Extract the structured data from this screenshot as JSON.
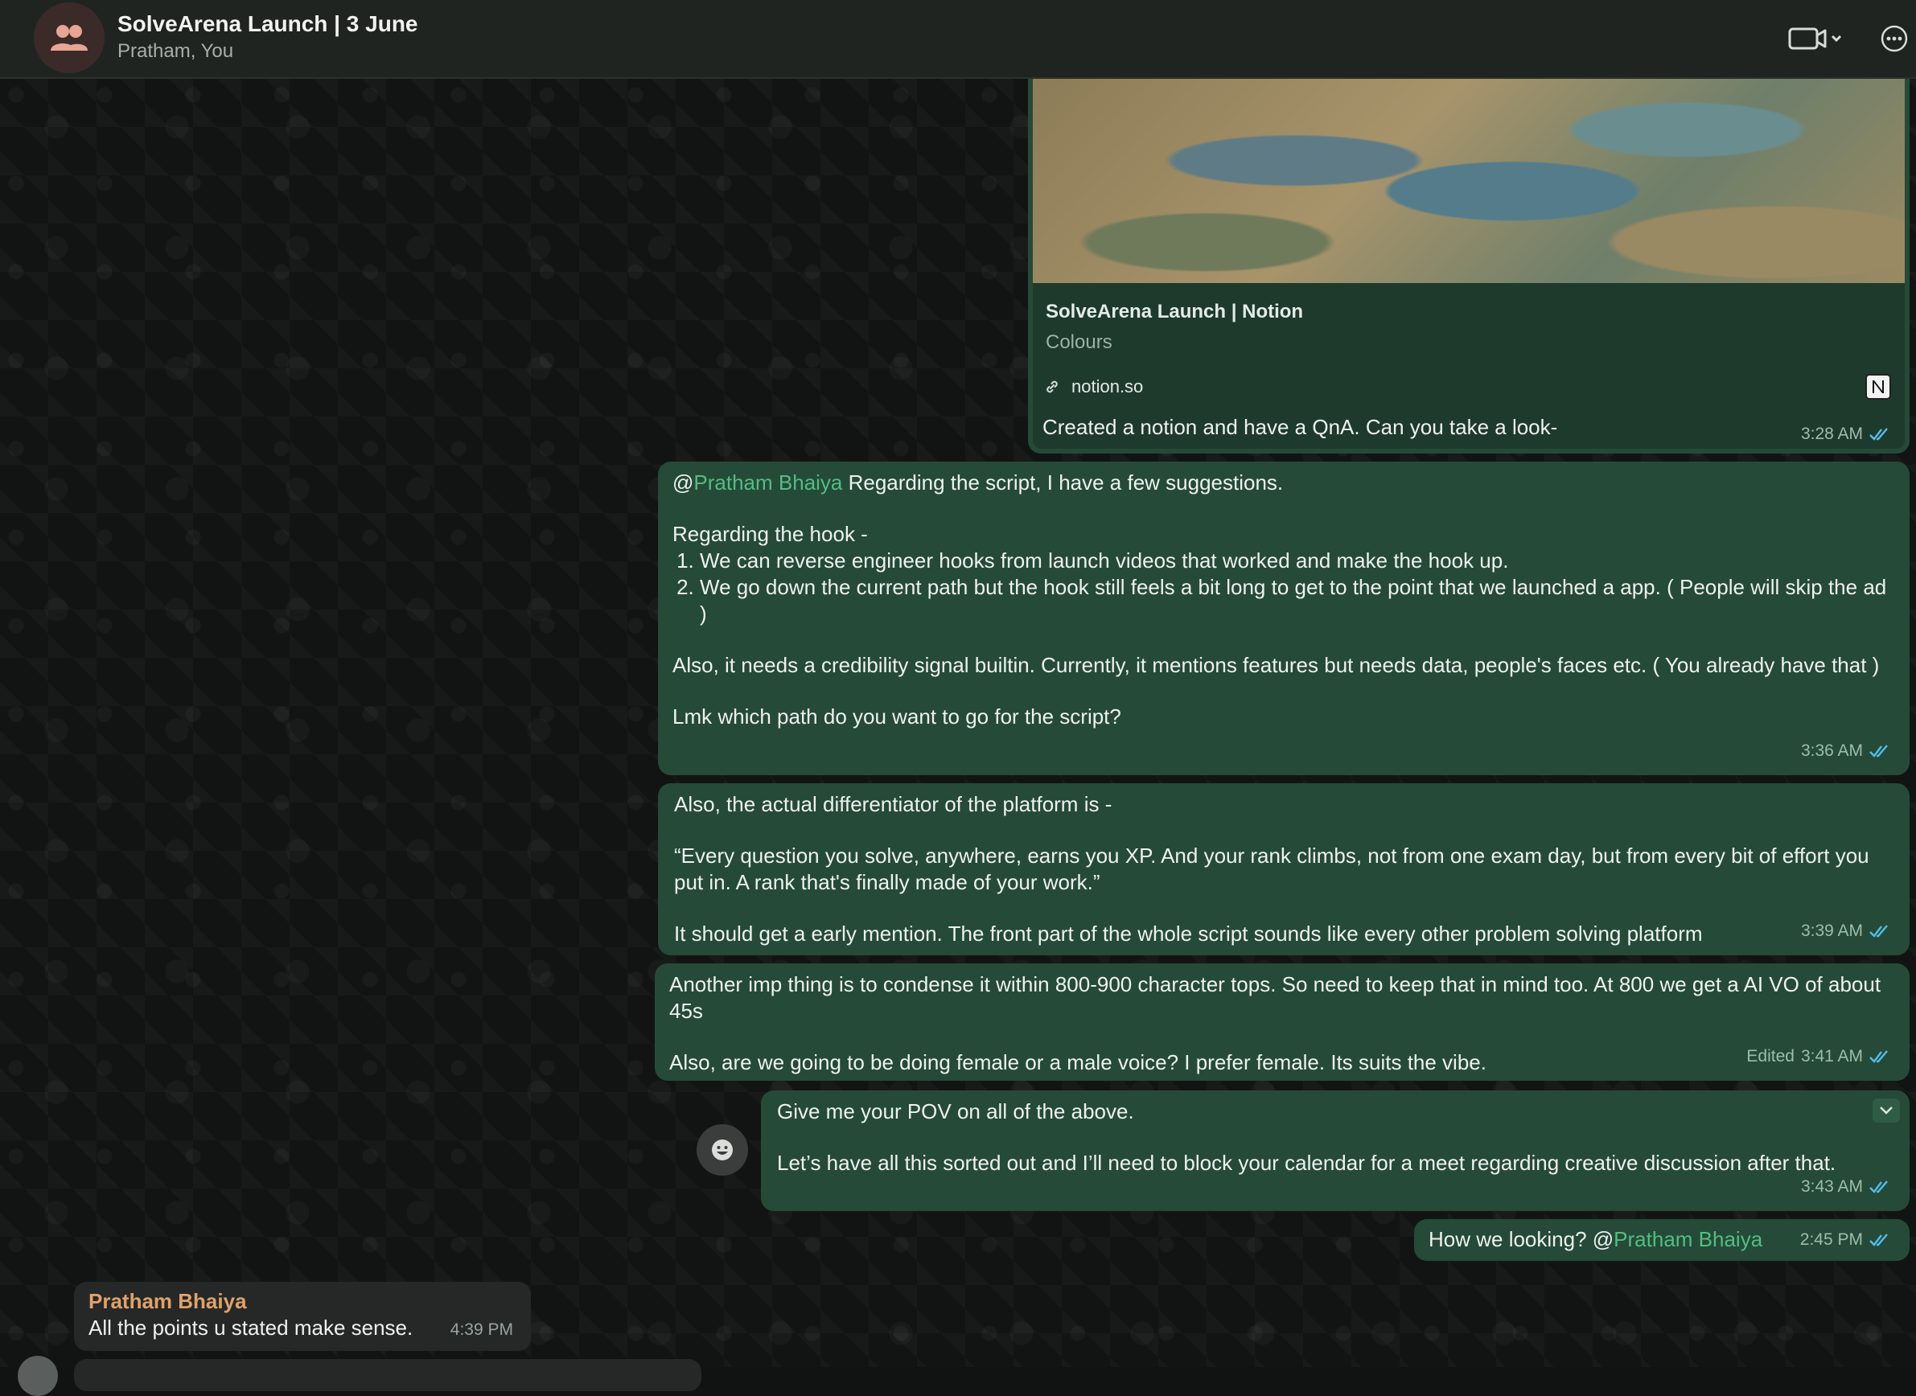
{
  "header": {
    "title": "SolveArena Launch | 3 June",
    "subtitle": "Pratham, You"
  },
  "link_preview": {
    "title": "SolveArena Launch | Notion",
    "description": "Colours",
    "domain": "notion.so",
    "message": "Created a notion and have a QnA. Can you take a look-",
    "time": "3:28 AM"
  },
  "messages": {
    "m1": {
      "mention": "Pratham Bhaiya",
      "line1": " Regarding the script, I have a few suggestions.",
      "hook_heading": "Regarding the hook -",
      "list": [
        "We can reverse engineer hooks from launch videos that worked and make the hook up.",
        "We go down the current path but the hook still feels a bit long to get to the point that we launched a app. ( People will skip the ad )"
      ],
      "para2": "Also, it needs a credibility signal builtin. Currently, it mentions features but needs data, people's faces etc. ( You already have that )",
      "para3": "Lmk which path do you want to go for the script?",
      "time": "3:36 AM"
    },
    "m2": {
      "line1": "Also, the actual differentiator of the platform is -",
      "quote": "“Every question you solve, anywhere, earns you XP. And your rank climbs, not from one exam day, but from every bit of effort you put in. A rank that's finally made of your work.”",
      "line3": "It should get a early mention. The front part of the whole script sounds like every other problem solving platform",
      "time": "3:39 AM"
    },
    "m3": {
      "para1": "Another imp thing is to condense it within 800-900 character tops. So need to keep that in mind too. At 800 we get a AI VO of about 45s",
      "para2": "Also, are we going to be doing female or a male voice? I prefer female. Its suits the vibe.",
      "edited": "Edited",
      "time": "3:41 AM"
    },
    "m4": {
      "para1": "Give me your POV on all of the above.",
      "para2": "Let’s have all this sorted out and I’ll need to block your calendar for a meet regarding creative discussion after that.",
      "time": "3:43 AM"
    },
    "m5": {
      "text": "How we looking? @",
      "mention": "Pratham Bhaiya",
      "time": "2:45 PM"
    },
    "m6": {
      "sender": "Pratham Bhaiya",
      "text": "All the points u stated make sense.",
      "time": "4:39 PM"
    }
  },
  "icons": {
    "avatar": "group-icon",
    "video": "video-camera-icon",
    "menu": "more-options-icon",
    "link": "link-icon",
    "notion": "notion-logo-icon",
    "react": "emoji-react-icon",
    "ticks": "double-check-icon",
    "dropdown": "chevron-down-icon"
  },
  "colors": {
    "outgoing_bubble": "#254a38",
    "incoming_bubble": "#252826",
    "mention": "#53bd82",
    "sender_name": "#e0a26a",
    "read_ticks": "#53bdeb"
  }
}
